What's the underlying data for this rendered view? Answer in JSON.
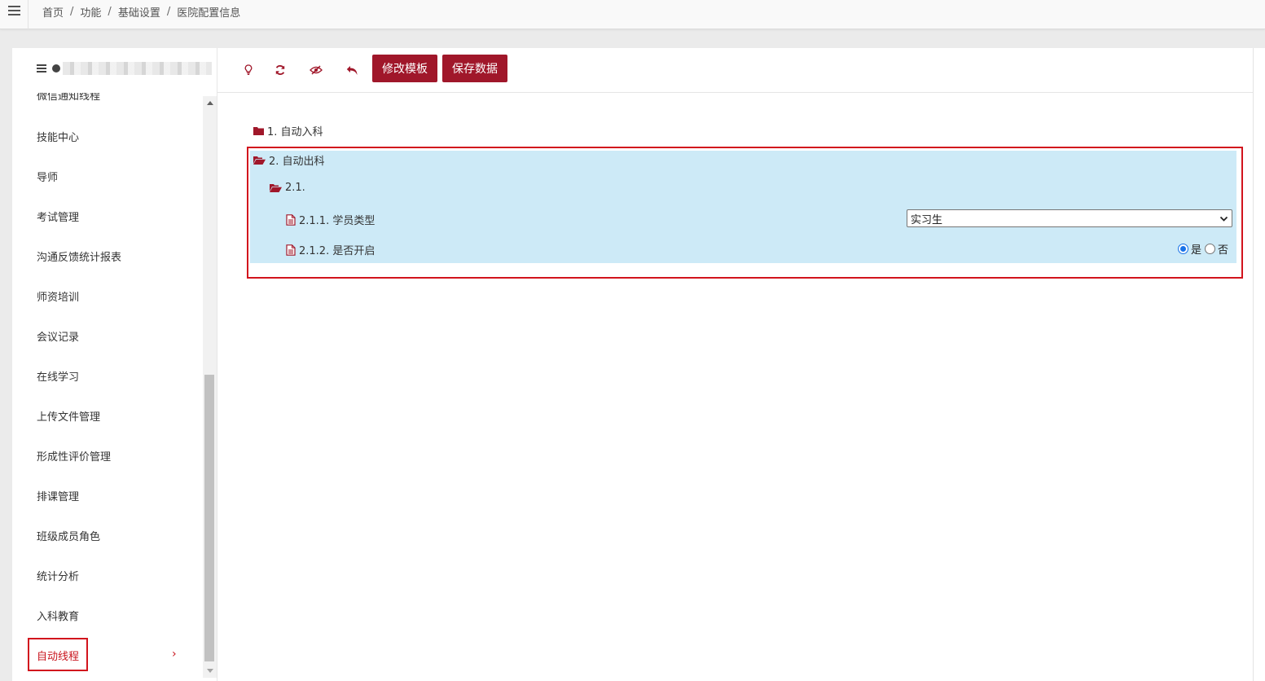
{
  "breadcrumb": {
    "items": [
      "首页",
      "功能",
      "基础设置",
      "医院配置信息"
    ],
    "separator": "/"
  },
  "sidebar": {
    "partial_item": "微信通知线程",
    "items": [
      {
        "label": "技能中心"
      },
      {
        "label": "导师"
      },
      {
        "label": "考试管理"
      },
      {
        "label": "沟通反馈统计报表"
      },
      {
        "label": "师资培训"
      },
      {
        "label": "会议记录"
      },
      {
        "label": "在线学习"
      },
      {
        "label": "上传文件管理"
      },
      {
        "label": "形成性评价管理"
      },
      {
        "label": "排课管理"
      },
      {
        "label": "班级成员角色"
      },
      {
        "label": "统计分析"
      },
      {
        "label": "入科教育"
      }
    ],
    "active_item": "自动线程",
    "active_chevron": "›"
  },
  "toolbar": {
    "icons": [
      "lightbulb-icon",
      "refresh-icon",
      "eye-slash-icon",
      "undo-icon"
    ],
    "edit_template_label": "修改模板",
    "save_data_label": "保存数据"
  },
  "tree": {
    "node1": "1. 自动入科",
    "node2": "2. 自动出科",
    "node2_1": "2.1.",
    "node2_1_1": "2.1.1. 学员类型",
    "node2_1_2": "2.1.2. 是否开启",
    "student_type_value": "实习生",
    "enabled_yes": "是",
    "enabled_no": "否",
    "enabled_selected": "是"
  },
  "colors": {
    "accent": "#a0172a",
    "highlight": "#d2141d",
    "selected_row": "#cdeaf7",
    "radio_checked": "#1a73e8"
  }
}
